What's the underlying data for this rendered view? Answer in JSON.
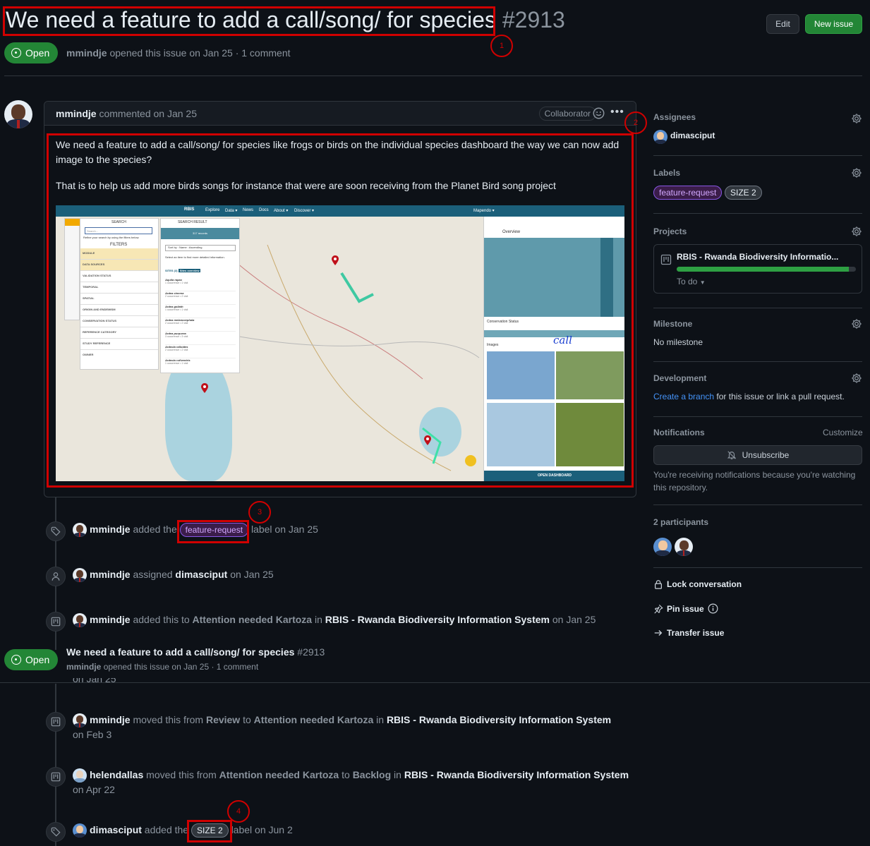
{
  "header": {
    "title": "We need a feature to add a call/song/ for species",
    "number": "#2913",
    "edit_label": "Edit",
    "new_issue_label": "New issue",
    "state": "Open",
    "author": "mmindje",
    "meta": "opened this issue on Jan 25 · 1 comment"
  },
  "comment": {
    "author": "mmindje",
    "meta": "commented on Jan 25",
    "badge": "Collaborator",
    "body_p1": "We need a feature to add a call/song/ for species like frogs or birds on the individual species dashboard the way we can now add image to the species?",
    "body_p2": "That is to help us add more birds songs for instance that were are soon receiving from the Planet Bird song project",
    "screenshot": {
      "nav_items": [
        "Explore",
        "Data ▾",
        "News",
        "Docs",
        "About ▾",
        "Discover ▾"
      ],
      "nav_right": "Mapendo ▾",
      "logo": "RBIS",
      "search_title": "SEARCH",
      "search_placeholder": "Search...",
      "refine_text": "Refine your search by using the filters below.",
      "filters_title": "FILTERS",
      "filters": [
        "MODULE",
        "DATA SOURCES",
        "VALIDATION STATUS",
        "TEMPORAL",
        "SPATIAL",
        "ORIGIN AND ENDEMISM",
        "CONSERVATION STATUS",
        "REFERENCE CATEGORY",
        "STUDY REFERENCE",
        "OWNER"
      ],
      "result_title": "SEARCH RESULT",
      "result_count": "317 records",
      "sort_label": "Sort by : Name : Ascending",
      "select_text": "Select an item to find more detailed information.",
      "sites_label": "SITES (3)",
      "sites_badge": "Sites overview",
      "species": [
        {
          "name": "Aquila rapax",
          "sub": "1 occurrence • 1 visit"
        },
        {
          "name": "Ardea cinerea",
          "sub": "2 occurrence • 2 visit"
        },
        {
          "name": "Ardea goliath",
          "sub": "1 occurrence • 1 visit"
        },
        {
          "name": "Ardea melanocephala",
          "sub": "2 occurrence • 2 visit"
        },
        {
          "name": "Ardea purpurea",
          "sub": "3 occurrence • 3 visit"
        },
        {
          "name": "Ardeola ralloides",
          "sub": "2 occurrence • 2 visit"
        },
        {
          "name": "Ardeola rufiventris",
          "sub": "1 occurrence • 1 visit"
        }
      ],
      "overview_title": "Overview",
      "conservation_label": "Conservation Status",
      "images_label": "Images",
      "handwriting": "call",
      "dashboard_button": "OPEN DASHBOARD"
    }
  },
  "timeline": [
    {
      "icon": "tag-icon",
      "actor": "mmindje",
      "pre": "added the",
      "label": "feature-request",
      "post": "label on Jan 25"
    },
    {
      "icon": "person-icon",
      "actor": "mmindje",
      "pre": "assigned",
      "target": "dimasciput",
      "post": "on Jan 25"
    },
    {
      "icon": "project-icon",
      "actor": "mmindje",
      "pre": "added this to",
      "col": "Attention needed Kartoza",
      "in": "in",
      "project": "RBIS - Rwanda Biodiversity Information System",
      "post": "on Jan 25"
    },
    {
      "icon": "project-icon",
      "actor": "mmindje",
      "pre": "moved this from",
      "from": "Review",
      "to_word": "to",
      "col": "Attention needed Kartoza",
      "in": "in",
      "project": "RBIS - Rwanda Biodiversity Information System",
      "post": "on Feb 3"
    },
    {
      "icon": "project-icon",
      "actor": "helendallas",
      "pre": "moved this from",
      "from": "Attention needed Kartoza",
      "to_word": "to",
      "col": "Backlog",
      "in": "in",
      "project": "RBIS - Rwanda Biodiversity Information System",
      "post": "on Apr 22"
    },
    {
      "icon": "tag-icon",
      "actor": "dimasciput",
      "pre": "added the",
      "label": "SIZE 2",
      "post": "label on Jun 2"
    }
  ],
  "sticky": {
    "state": "Open",
    "title": "We need a feature to add a call/song/ for species",
    "number": "#2913",
    "author": "mmindje",
    "meta": "opened this issue on Jan 25 · 1 comment",
    "clipped": "on Jan 25"
  },
  "sidebar": {
    "assignees_title": "Assignees",
    "assignee": "dimasciput",
    "labels_title": "Labels",
    "labels": [
      "feature-request",
      "SIZE 2"
    ],
    "projects_title": "Projects",
    "project_name": "RBIS - Rwanda Biodiversity Informatio...",
    "project_status": "To do",
    "project_progress": 0.96,
    "milestone_title": "Milestone",
    "milestone_value": "No milestone",
    "development_title": "Development",
    "dev_link": "Create a branch",
    "dev_text": "for this issue or link a pull request.",
    "notifications_title": "Notifications",
    "customize": "Customize",
    "unsubscribe": "Unsubscribe",
    "notif_text": "You're receiving notifications because you're watching this repository.",
    "participants_title": "2 participants",
    "lock": "Lock conversation",
    "pin": "Pin issue",
    "transfer": "Transfer issue"
  },
  "annotations": [
    "1",
    "2",
    "3",
    "4"
  ],
  "colors": {
    "accent_green": "#238636",
    "link_blue": "#4493f8",
    "annotation_red": "#d00000",
    "background": "#0d1117"
  }
}
